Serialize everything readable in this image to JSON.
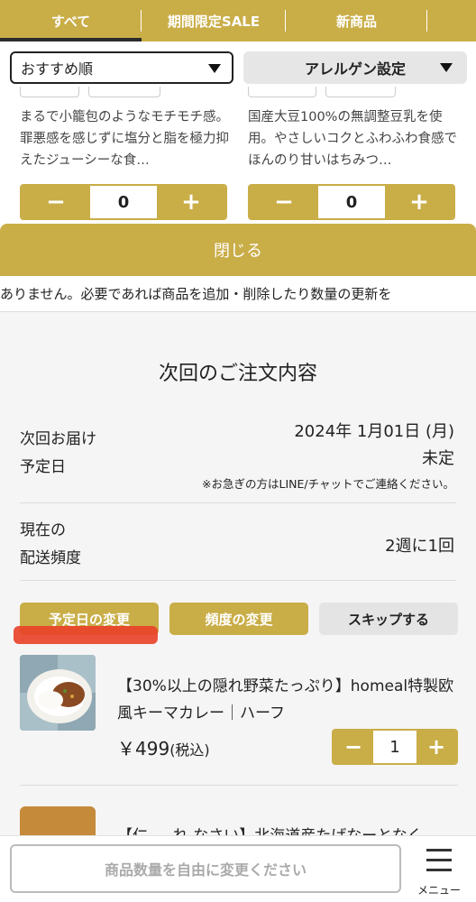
{
  "tabs": [
    {
      "label": "すべて"
    },
    {
      "label": "期間限定SALE"
    },
    {
      "label": "新商品"
    },
    {
      "label": ""
    }
  ],
  "filters": {
    "sort_value": "おすすめ順",
    "allergy_label": "アレルゲン設定"
  },
  "products": [
    {
      "description": "まるで小籠包のようなモチモチ感。罪悪感を感じずに塩分と脂を極力抑えたジューシーな食…",
      "quantity": "0",
      "minus": "−",
      "plus": "+"
    },
    {
      "description": "国産大豆100%の無調整豆乳を使用。やさしいコクとふわふわ食感でほんのり甘いはちみつ…",
      "quantity": "0",
      "minus": "−",
      "plus": "+"
    }
  ],
  "close_label": "閉じる",
  "notice_text": "ありません。必要であれば商品を追加・削除したり数量の更新を",
  "order": {
    "title": "次回のご注文内容",
    "delivery_label_1": "次回お届け",
    "delivery_label_2": "予定日",
    "delivery_date": "2024年 1月01日 (月)",
    "delivery_status": "未定",
    "delivery_note": "※お急ぎの方はLINE/チャットでご連絡ください。",
    "frequency_label_1": "現在の",
    "frequency_label_2": "配送頻度",
    "frequency_value": "2週に1回",
    "actions": {
      "change_date": "予定日の変更",
      "change_frequency": "頻度の変更",
      "skip": "スキップする"
    },
    "item": {
      "name": "【30%以上の隠れ野菜たっぷり】homeal特製欧風キーマカレー｜ハーフ",
      "price": "￥499",
      "tax": "(税込)",
      "quantity": "1",
      "minus": "−",
      "plus": "+"
    },
    "next_item_partial": "【仁 ― れ なさい】北海道産たげなーとなく"
  },
  "bottom": {
    "edit_quantity_label": "商品数量を自由に変更ください",
    "menu_label": "メニュー"
  },
  "colors": {
    "accent_gold": "#c9ad47",
    "highlight_red": "#e8432a"
  }
}
